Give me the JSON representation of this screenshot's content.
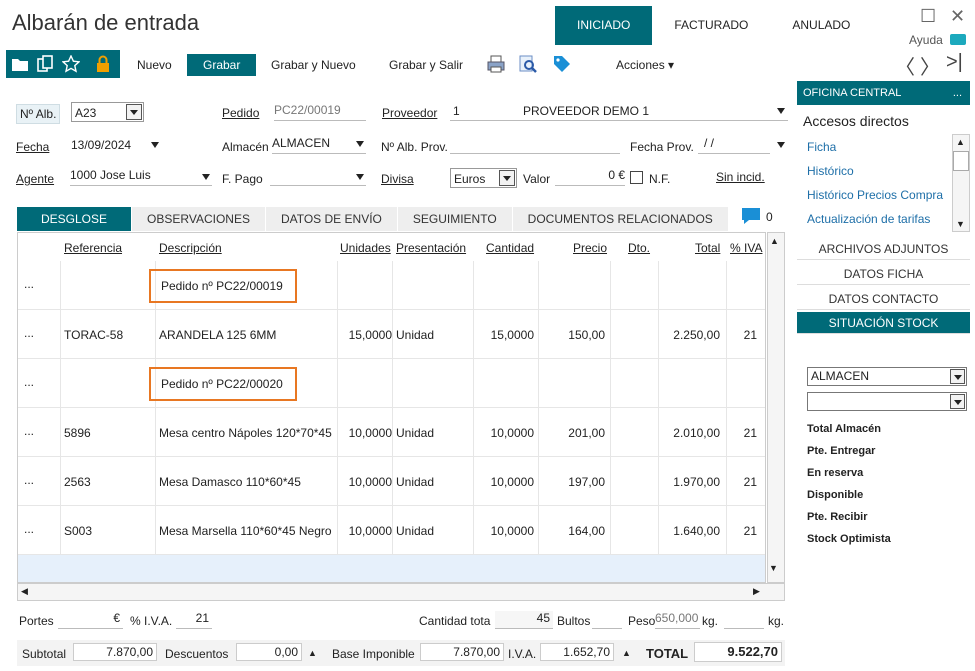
{
  "window": {
    "title": "Albarán de entrada",
    "help": "Ayuda"
  },
  "status_tabs": [
    "INICIADO",
    "FACTURADO",
    "ANULADO"
  ],
  "toolbar": {
    "nuevo": "Nuevo",
    "grabar": "Grabar",
    "grabar_nuevo": "Grabar y Nuevo",
    "grabar_salir": "Grabar y Salir",
    "acciones": "Acciones"
  },
  "header": {
    "n_alb_label": "Nº Alb.",
    "n_alb_value": "A23",
    "pedido_label": "Pedido",
    "pedido_value": "PC22/00019",
    "proveedor_label": "Proveedor",
    "proveedor_code": "1",
    "proveedor_name": "PROVEEDOR DEMO 1",
    "fecha_label": "Fecha",
    "fecha_value": "13/09/2024",
    "almacen_label": "Almacén",
    "almacen_value": "ALMACEN",
    "n_alb_prov_label": "Nº Alb. Prov.",
    "fecha_prov_label": "Fecha Prov.",
    "fecha_prov_value": "/ /",
    "agente_label": "Agente",
    "agente_value": "1000 Jose Luis",
    "fpago_label": "F. Pago",
    "divisa_label": "Divisa",
    "divisa_value": "Euros",
    "valor_label": "Valor",
    "valor_value": "0 €",
    "nf_label": "N.F.",
    "sin_incid": "Sin incid."
  },
  "tabs": [
    "DESGLOSE",
    "OBSERVACIONES",
    "DATOS DE ENVÍO",
    "SEGUIMIENTO",
    "DOCUMENTOS RELACIONADOS"
  ],
  "comments_count": "0",
  "grid": {
    "columns": [
      "Referencia",
      "Descripción",
      "Unidades",
      "Presentación",
      "Cantidad",
      "Precio",
      "Dto.",
      "Total",
      "% IVA"
    ],
    "rows": [
      {
        "dots": "...",
        "ref": "",
        "desc": "Pedido nº PC22/00019",
        "uds": "",
        "pres": "",
        "cant": "",
        "precio": "",
        "dto": "",
        "total": "",
        "iva": "",
        "boxed": true
      },
      {
        "dots": "...",
        "ref": "TORAC-58",
        "desc": "ARANDELA 125 6MM",
        "uds": "15,0000",
        "pres": "Unidad",
        "cant": "15,0000",
        "precio": "150,00",
        "dto": "",
        "total": "2.250,00",
        "iva": "21",
        "boxed": false
      },
      {
        "dots": "...",
        "ref": "",
        "desc": "Pedido nº PC22/00020",
        "uds": "",
        "pres": "",
        "cant": "",
        "precio": "",
        "dto": "",
        "total": "",
        "iva": "",
        "boxed": true
      },
      {
        "dots": "...",
        "ref": "5896",
        "desc": "Mesa centro Nápoles 120*70*45",
        "uds": "10,0000",
        "pres": "Unidad",
        "cant": "10,0000",
        "precio": "201,00",
        "dto": "",
        "total": "2.010,00",
        "iva": "21",
        "boxed": false
      },
      {
        "dots": "...",
        "ref": "2563",
        "desc": "Mesa Damasco 110*60*45",
        "uds": "10,0000",
        "pres": "Unidad",
        "cant": "10,0000",
        "precio": "197,00",
        "dto": "",
        "total": "1.970,00",
        "iva": "21",
        "boxed": false
      },
      {
        "dots": "...",
        "ref": "S003",
        "desc": "Mesa Marsella 110*60*45 Negro",
        "uds": "10,0000",
        "pres": "Unidad",
        "cant": "10,0000",
        "precio": "164,00",
        "dto": "",
        "total": "1.640,00",
        "iva": "21",
        "boxed": false
      }
    ]
  },
  "footer": {
    "portes_label": "Portes",
    "portes_unit": "€",
    "iva_label": "% I.V.A.",
    "iva_value": "21",
    "cantidad_label": "Cantidad tota",
    "cantidad_value": "45",
    "bultos_label": "Bultos",
    "peso_label": "Peso",
    "peso_value": "650,000",
    "kg1": "kg.",
    "kg2": "kg.",
    "subtotal_label": "Subtotal",
    "subtotal_value": "7.870,00",
    "descuentos_label": "Descuentos",
    "descuentos_value": "0,00",
    "base_label": "Base Imponible",
    "base_value": "7.870,00",
    "iva2_label": "I.V.A.",
    "iva2_value": "1.652,70",
    "total_label": "TOTAL",
    "total_value": "9.522,70"
  },
  "sidebar": {
    "office": "OFICINA CENTRAL",
    "office_more": "...",
    "accesos": "Accesos directos",
    "links": [
      "Ficha",
      "Histórico",
      "Histórico Precios Compra",
      "Actualización de tarifas"
    ],
    "sections": [
      "ARCHIVOS ADJUNTOS",
      "DATOS FICHA",
      "DATOS CONTACTO",
      "SITUACIÓN STOCK"
    ],
    "almacen_combo": "ALMACEN",
    "stats": [
      "Total Almacén",
      "Pte. Entregar",
      "En reserva",
      "Disponible",
      "Pte. Recibir",
      "Stock Optimista"
    ]
  },
  "colors": {
    "accent": "#006a78",
    "lock": "#f0a000",
    "link": "#1e6fa8",
    "highlight_box": "#e87722"
  }
}
